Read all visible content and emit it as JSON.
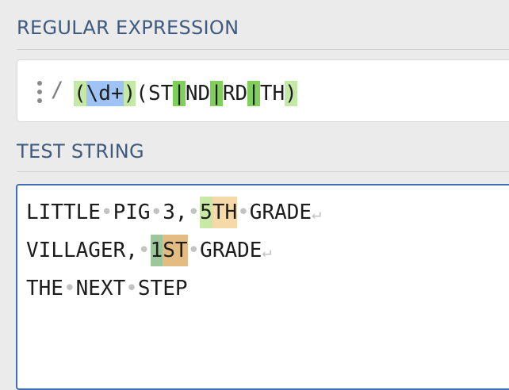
{
  "sections": {
    "regex_title": "REGULAR EXPRESSION",
    "test_title": "TEST STRING"
  },
  "regex": {
    "delimiter": "/",
    "parts": {
      "open1": "(",
      "esc": "\\d+",
      "close1": ")",
      "open2": "(",
      "alt1": "ST",
      "pipe1": "|",
      "alt2": "ND",
      "pipe2": "|",
      "alt3": "RD",
      "pipe3": "|",
      "alt4": "TH",
      "close2": ")"
    }
  },
  "test_string": {
    "line1": {
      "w1": "LITTLE",
      "w2": "PIG",
      "w3": "3,",
      "match_group1": "5",
      "match_group2": "TH",
      "w4": "GRADE"
    },
    "line2": {
      "w1": "VILLAGER,",
      "match_group1": "1",
      "match_group2": "ST",
      "w2": "GRADE"
    },
    "line3": {
      "w1": "THE",
      "w2": "NEXT",
      "w3": "STEP"
    },
    "space_glyph": "•",
    "return_glyph": "↵"
  },
  "colors": {
    "title": "#3e5a7f",
    "group_highlight": "#c4e8a5",
    "escape_highlight": "#9fc3f5",
    "pipe_highlight": "#7fcf5a",
    "focus_border": "#3f6db6"
  }
}
